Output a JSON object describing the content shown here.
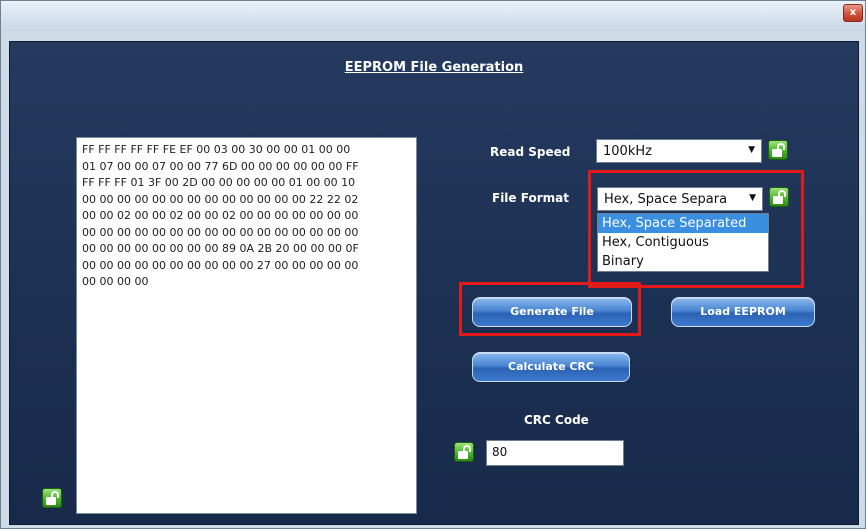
{
  "window": {
    "close_glyph": "x"
  },
  "panel": {
    "title": "EEPROM File Generation"
  },
  "eeprom_data": {
    "lines": [
      "FF FF FF FF FF FE EF 00 03 00 30 00 00 01 00 00",
      "01 07 00 00 07 00 00 77 6D 00 00 00 00 00 00 FF",
      "FF FF FF 01 3F 00 2D 00 00 00 00 00 01 00 00 10",
      "00 00 00 00 00 00 00 00 00 00 00 00 00 22 22 02",
      "00 00 02 00 00 02 00 00 02 00 00 00 00 00 00 00",
      "00 00 00 00 00 00 00 00 00 00 00 00 00 00 00 00",
      "00 00 00 00 00 00 00 00 89 0A 2B 20 00 00 00 0F",
      "00 00 00 00 00 00 00 00 00 00 27 00 00 00 00 00",
      "00 00 00 00"
    ]
  },
  "read_speed": {
    "label": "Read Speed",
    "value": "100kHz"
  },
  "file_format": {
    "label": "File Format",
    "value": "Hex, Space Separa",
    "options": [
      "Hex, Space Separated",
      "Hex, Contiguous",
      "Binary"
    ],
    "selected_index": 0
  },
  "buttons": {
    "generate": "Generate File",
    "load": "Load EEPROM",
    "crc": "Calculate CRC"
  },
  "crc": {
    "label": "CRC Code",
    "value": "80"
  },
  "icons": {
    "lock": "unlocked-padlock-icon"
  },
  "colors": {
    "highlight": "#e21a1a",
    "panel": "#1d3154",
    "button": "#3c7ad0"
  }
}
